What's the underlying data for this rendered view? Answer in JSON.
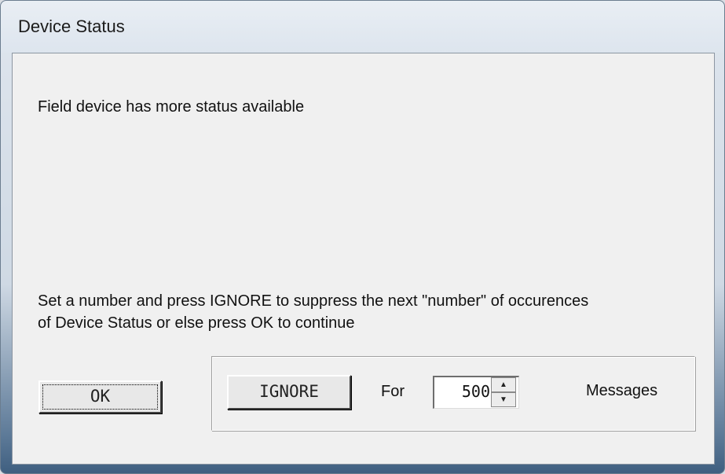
{
  "window": {
    "title": "Device Status"
  },
  "message": {
    "status_text": "Field device has more status available",
    "instruction_line1": "Set a number and press IGNORE to suppress the next \"number\" of occurences",
    "instruction_line2": "of Device Status or else press OK to continue"
  },
  "buttons": {
    "ok_label": "OK",
    "ignore_label": "IGNORE"
  },
  "ignore_group": {
    "for_label": "For",
    "count_value": "500",
    "messages_label": "Messages",
    "spin_up_glyph": "▲",
    "spin_down_glyph": "▼"
  }
}
